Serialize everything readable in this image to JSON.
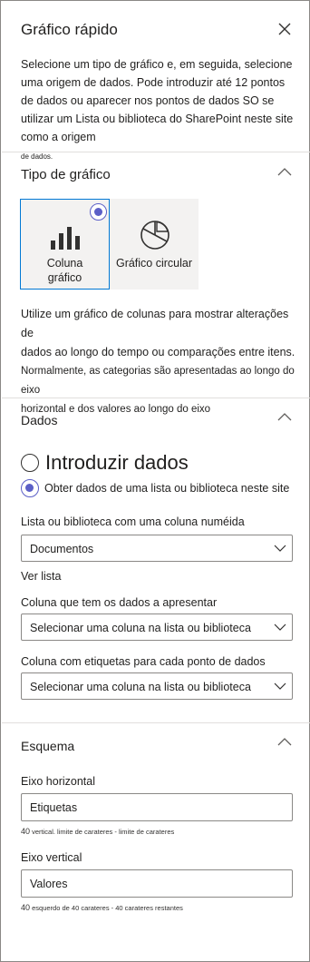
{
  "header": {
    "title": "Gráfico rápido",
    "intro": "Selecione um tipo de gráfico e, em seguida, selecione uma origem de dados. Pode introduzir até 12 pontos de dados ou aparecer nos pontos de dados SO se utilizar um Lista ou biblioteca do SharePoint neste site como a origem",
    "intro_small": "de dados."
  },
  "chart_type": {
    "title": "Tipo de gráfico",
    "options": [
      {
        "label_line1": "Coluna",
        "label_line2": "gráfico",
        "selected": true
      },
      {
        "label": "Gráfico circular",
        "selected": false
      }
    ],
    "desc_line1": "Utilize um gráfico de colunas para mostrar alterações de",
    "desc_line2": "dados ao longo do tempo ou comparações entre itens.",
    "desc_line3": "Normalmente, as categorias são apresentadas ao longo do eixo",
    "desc_line4": "horizontal e dos valores ao longo do eixo"
  },
  "data": {
    "title": "Dados",
    "option_enter": "Introduzir dados",
    "option_list": "Obter dados de uma lista ou biblioteca neste site",
    "list_label": "Lista ou biblioteca com uma coluna numéida",
    "list_value": "Documentos",
    "view_list": "Ver lista",
    "values_col_label": "Coluna que tem os dados a apresentar",
    "values_col_value": "Selecionar uma coluna na lista ou biblioteca",
    "labels_col_label": "Coluna com etiquetas para cada ponto de dados",
    "labels_col_value": "Selecionar uma coluna na lista ou biblioteca"
  },
  "layout": {
    "title": "Esquema",
    "h_axis_label": "Eixo horizontal",
    "h_axis_value": "Etiquetas",
    "h_hint_num": "40",
    "h_hint": "vertical. limite de carateres - limite de carateres",
    "v_axis_label": "Eixo vertical",
    "v_axis_value": "Valores",
    "v_hint_num": "40",
    "v_hint": "esquerdo de 40 carateres - 40 carateres restantes"
  },
  "colors": {
    "accent": "#5b5fc7",
    "tile_border": "#0078d4",
    "divider": "#e1dfdd"
  },
  "icons": [
    "close-icon",
    "chevron-up-icon",
    "column-chart-icon",
    "pie-chart-icon",
    "chevron-down-icon"
  ]
}
